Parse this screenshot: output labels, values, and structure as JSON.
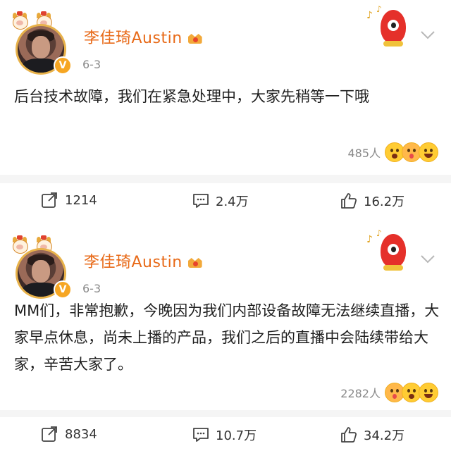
{
  "posts": [
    {
      "author": "李佳琦Austin",
      "date": "6-3",
      "content": "后台技术故障，我们在紧急处理中，大家先稍等一下哦",
      "reaction_count": "485人",
      "reactions": [
        "surprised-emoji",
        "kiss-emoji",
        "laugh-emoji"
      ],
      "forward_count": "1214",
      "comment_count": "2.4万",
      "like_count": "16.2万"
    },
    {
      "author": "李佳琦Austin",
      "date": "6-3",
      "content": "MM们，非常抱歉，今晚因为我们内部设备故障无法继续直播，大家早点休息，尚未上播的产品，我们之后的直播中会陆续带给大家，辛苦大家了。",
      "reaction_count": "2282人",
      "reactions": [
        "kiss-emoji",
        "sad-emoji",
        "laugh-emoji"
      ],
      "forward_count": "8834",
      "comment_count": "10.7万",
      "like_count": "34.2万"
    }
  ],
  "colors": {
    "author": "#e86a18",
    "muted": "#8a8a8a",
    "text": "#1f1f1f"
  }
}
